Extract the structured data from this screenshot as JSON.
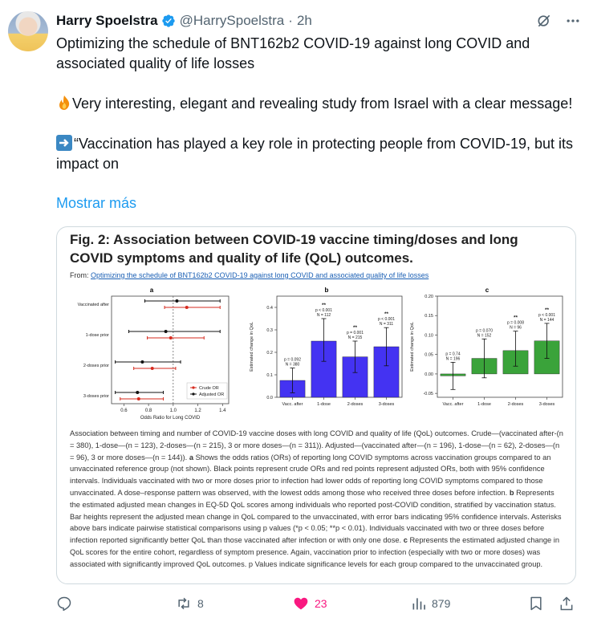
{
  "author": {
    "name": "Harry Spoelstra",
    "handle": "@HarrySpoelstra",
    "separator": "·",
    "time": "2h"
  },
  "tweet": {
    "line1": "Optimizing the schedule of BNT162b2 COVID-19 against long COVID and associated quality of life losses",
    "line2": "Very interesting, elegant and revealing study from Israel with a clear message!",
    "line3": "“Vaccination has played a key role in protecting people from COVID-19, but its impact on",
    "show_more": "Mostrar más"
  },
  "figure": {
    "title": "Fig. 2: Association between COVID-19 vaccine timing/doses and long COVID symptoms and quality of life (QoL) outcomes.",
    "from_prefix": "From: ",
    "from_link": "Optimizing the schedule of BNT162b2 COVID-19 against long COVID and associated quality of life losses",
    "caption_parts": [
      "Association between timing and number of COVID-19 vaccine doses with long COVID and quality of life (QoL) outcomes. Crude—(vaccinated after-(n = 380), 1-dose—(n = 123), 2-doses—(n = 215), 3 or more doses—(n = 311)). Adjusted—(vaccinated after—(n = 196), 1-dose—(n = 62), 2-doses—(n = 96), 3 or more doses—(n = 144)).",
      "a",
      "Shows the odds ratios (ORs) of reporting long COVID symptoms across vaccination groups compared to an unvaccinated reference group (not shown). Black points represent crude ORs and red points represent adjusted ORs, both with 95% confidence intervals. Individuals vaccinated with two or more doses prior to infection had lower odds of reporting long COVID symptoms compared to those unvaccinated. A dose–response pattern was observed, with the lowest odds among those who received three doses before infection.",
      "b",
      "Represents the estimated adjusted mean changes in EQ-5D QoL scores among individuals who reported post-COVID condition, stratified by vaccination status. Bar heights represent the adjusted mean change in QoL compared to the unvaccinated, with error bars indicating 95% confidence intervals. Asterisks above bars indicate pairwise statistical comparisons using p values (*p < 0.05; **p < 0.01). Individuals vaccinated with two or three doses before infection reported significantly better QoL than those vaccinated after infection or with only one dose.",
      "c",
      "Represents the estimated adjusted change in QoL scores for the entire cohort, regardless of symptom presence. Again, vaccination prior to infection (especially with two or more doses) was associated with significantly improved QoL outcomes. p Values indicate significance levels for each group compared to the unvaccinated group."
    ]
  },
  "chart_data": [
    {
      "type": "scatter",
      "panel_label": "a",
      "xlabel": "Odds Ratio for Long COVID",
      "ylabel": "",
      "categories": [
        "Vaccinated after",
        "1-dose prior",
        "2-doses prior",
        "3-doses prior"
      ],
      "xlim": [
        0.5,
        1.45
      ],
      "xticks": [
        "0.6",
        "0.8",
        "1.0",
        "1.2",
        "1.4"
      ],
      "reference_line": 1.0,
      "legend": [
        "Crude OR",
        "Adjusted OR"
      ],
      "legend_position": "lower-right",
      "series": [
        {
          "name": "Crude OR",
          "color": "#d62a1e",
          "points": [
            {
              "y": "Vaccinated after",
              "x": 1.11,
              "lo": 0.93,
              "hi": 1.38
            },
            {
              "y": "1-dose prior",
              "x": 0.98,
              "lo": 0.79,
              "hi": 1.25
            },
            {
              "y": "2-doses prior",
              "x": 0.83,
              "lo": 0.68,
              "hi": 1.02
            },
            {
              "y": "3-doses prior",
              "x": 0.72,
              "lo": 0.57,
              "hi": 0.92
            }
          ]
        },
        {
          "name": "Adjusted OR",
          "color": "#111111",
          "points": [
            {
              "y": "Vaccinated after",
              "x": 1.03,
              "lo": 0.77,
              "hi": 1.38
            },
            {
              "y": "1-dose prior",
              "x": 0.94,
              "lo": 0.64,
              "hi": 1.38
            },
            {
              "y": "2-doses prior",
              "x": 0.75,
              "lo": 0.53,
              "hi": 1.06
            },
            {
              "y": "3-doses prior",
              "x": 0.71,
              "lo": 0.53,
              "hi": 0.92
            }
          ]
        }
      ]
    },
    {
      "type": "bar",
      "panel_label": "b",
      "ylabel": "Estimated change in QoL",
      "categories": [
        "Vacc. after",
        "1-dose",
        "2-doses",
        "3-doses"
      ],
      "values": [
        0.075,
        0.25,
        0.18,
        0.225
      ],
      "ci_low": [
        0.02,
        0.16,
        0.11,
        0.14
      ],
      "ci_high": [
        0.13,
        0.35,
        0.25,
        0.31
      ],
      "labels": [
        [
          "p = 0.092",
          "N = 380"
        ],
        [
          "**",
          "p < 0.001",
          "N = 112"
        ],
        [
          "**",
          "p = 0.001",
          "N = 215"
        ],
        [
          "**",
          "p < 0.001",
          "N = 311"
        ]
      ],
      "ylim": [
        0,
        0.45
      ],
      "yticks": [
        "0.0",
        "0.1",
        "0.2",
        "0.3",
        "0.4"
      ],
      "color": "#4433f2"
    },
    {
      "type": "bar",
      "panel_label": "c",
      "ylabel": "Estimated change in QoL",
      "categories": [
        "Vacc. after",
        "1-dose",
        "2-doses",
        "3-doses"
      ],
      "values": [
        -0.005,
        0.04,
        0.06,
        0.085
      ],
      "ci_low": [
        -0.04,
        -0.01,
        0.02,
        0.04
      ],
      "ci_high": [
        0.03,
        0.09,
        0.11,
        0.13
      ],
      "labels": [
        [
          "p = 0.74",
          "N = 196"
        ],
        [
          "p = 0.070",
          "N = 152"
        ],
        [
          "**",
          "p = 0.008",
          "N = 96"
        ],
        [
          "**",
          "p < 0.001",
          "N = 144"
        ]
      ],
      "ylim": [
        -0.06,
        0.2
      ],
      "yticks": [
        "-0.05",
        "0.00",
        "0.05",
        "0.10",
        "0.15",
        "0.20"
      ],
      "color": "#3aa33a"
    }
  ],
  "actions": {
    "reply_count": "",
    "retweet_count": "8",
    "like_count": "23",
    "views_count": "879"
  },
  "colors": {
    "link": "#1d9bf0",
    "like": "#f91880",
    "muted": "#536471",
    "verified": "#1d9bf0"
  },
  "icons": [
    "verified-badge-icon",
    "grok-icon",
    "more-icon",
    "fire-emoji",
    "right-arrow-emoji",
    "reply-icon",
    "retweet-icon",
    "heart-icon",
    "views-icon",
    "bookmark-icon",
    "share-icon"
  ]
}
